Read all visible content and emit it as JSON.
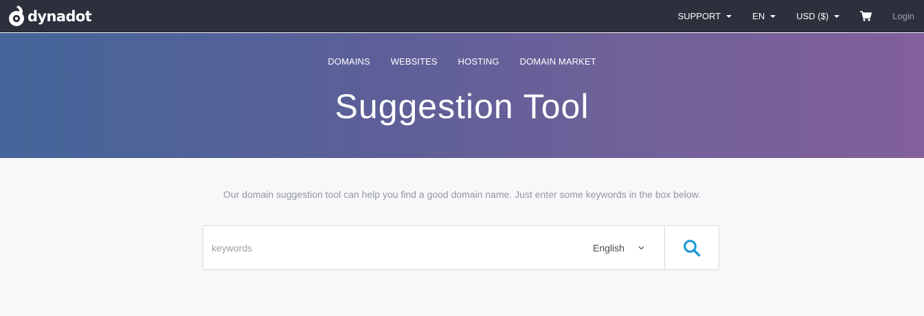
{
  "brand": {
    "name": "dynadot",
    "logo_icon": "dynadot-logo-icon"
  },
  "topbar": {
    "support": "SUPPORT",
    "language": "EN",
    "currency": "USD ($)",
    "cart_icon": "cart-icon",
    "login": "Login"
  },
  "hero": {
    "nav": [
      "DOMAINS",
      "WEBSITES",
      "HOSTING",
      "DOMAIN MARKET"
    ],
    "title": "Suggestion Tool"
  },
  "main": {
    "description": "Our domain suggestion tool can help you find a good domain name. Just enter some keywords in the box below.",
    "search": {
      "placeholder": "keywords",
      "value": "",
      "language_selected": "English",
      "button_icon": "search-icon"
    }
  },
  "colors": {
    "topbar": "#2c303c",
    "hero_start": "#44669a",
    "hero_end": "#82609b",
    "accent": "#1d9ad6",
    "background": "#f8f8fa"
  }
}
